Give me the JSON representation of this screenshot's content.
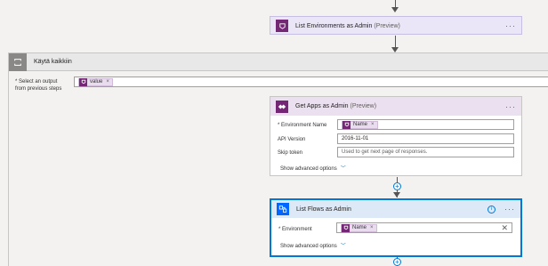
{
  "list_env_card": {
    "title": "List Environments as Admin",
    "preview": "(Preview)",
    "more": "···"
  },
  "apply_each": {
    "title": "Käytä kaikkiin",
    "select_label_line1": "* Select an output",
    "select_label_line2": "from previous steps",
    "token_value": "value"
  },
  "get_apps_card": {
    "title": "Get Apps as Admin",
    "preview": "(Preview)",
    "more": "···",
    "env_label": "* Environment Name",
    "env_token": "Name",
    "api_label": "API Version",
    "api_value": "2016-11-01",
    "skip_label": "Skip token",
    "skip_placeholder": "Used to get next page of responses.",
    "advanced": "Show advanced options"
  },
  "list_flows_card": {
    "title": "List Flows as Admin",
    "more": "···",
    "env_label": "* Environment",
    "env_token": "Name",
    "advanced": "Show advanced options"
  },
  "colors": {
    "powerapps_purple": "#742774",
    "flow_blue": "#0066ff",
    "loop_gray": "#8a8886",
    "selected_border": "#0078d4"
  }
}
